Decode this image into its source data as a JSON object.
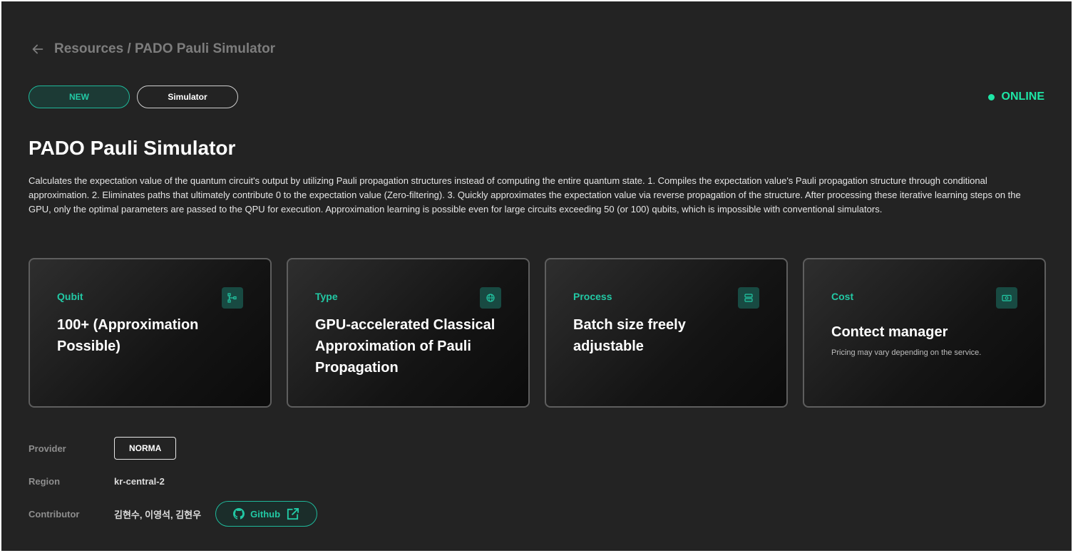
{
  "breadcrumb": {
    "text": "Resources / PADO Pauli Simulator",
    "back_icon": "arrow-left-icon"
  },
  "tags": {
    "new": "NEW",
    "simulator": "Simulator"
  },
  "status": {
    "label": "ONLINE",
    "color": "#1ee6a6"
  },
  "title": "PADO Pauli Simulator",
  "description": "Calculates the expectation value of the quantum circuit's output by utilizing Pauli propagation structures instead of computing the entire quantum state. 1. Compiles the expectation value's Pauli propagation structure through conditional approximation. 2. Eliminates paths that ultimately contribute 0 to the expectation value (Zero-filtering). 3. Quickly approximates the expectation value via reverse propagation of the structure. After processing these iterative learning steps on the GPU, only the optimal parameters are passed to the QPU for execution. Approximation learning is possible even for large circuits exceeding 50 (or 100) qubits, which is impossible with conventional simulators.",
  "cards": [
    {
      "label": "Qubit",
      "value": "100+ (Approximation Possible)",
      "icon": "circuit-icon"
    },
    {
      "label": "Type",
      "value": "GPU-accelerated Classical Approximation of Pauli Propagation",
      "icon": "globe-icon"
    },
    {
      "label": "Process",
      "value": "Batch size freely adjustable",
      "icon": "server-icon"
    },
    {
      "label": "Cost",
      "value": "Contect manager",
      "note": "Pricing may vary depending on the service.",
      "icon": "money-icon"
    }
  ],
  "meta": {
    "provider_label": "Provider",
    "provider": "NORMA",
    "region_label": "Region",
    "region": "kr-central-2",
    "contributor_label": "Contributor",
    "contributors": "김현수, 이영석, 김현우",
    "github_label": "Github"
  },
  "colors": {
    "accent": "#22c9a5",
    "background": "#232323"
  }
}
